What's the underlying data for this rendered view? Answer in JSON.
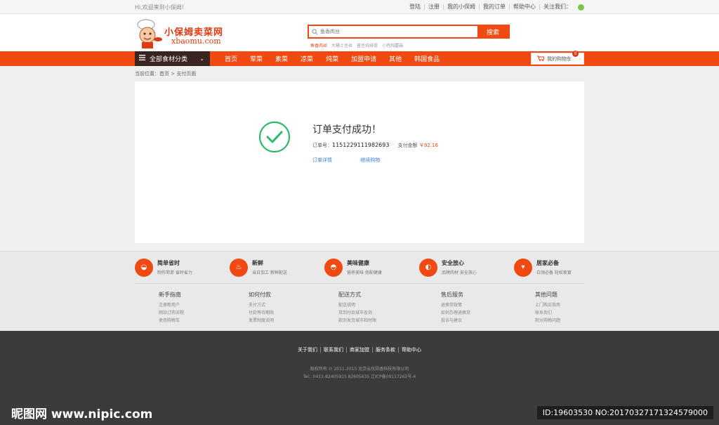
{
  "topbar": {
    "welcome": "Hi,欢迎来到小保姆!",
    "links": [
      "登陆",
      "注册",
      "我的小保姆",
      "我的订单",
      "帮助中心",
      "关注我们："
    ]
  },
  "header": {
    "logo_cn": "小保姆卖菜网",
    "logo_en": "xbaomu.com",
    "search_placeholder": "鱼香肉丝",
    "search_button": "搜索",
    "hot_words": [
      "鱼香肉丝",
      "大桶土豆丝",
      "普豆炖排骨",
      "小鸡炖蘑菇"
    ]
  },
  "nav": {
    "category_label": "全部食材分类",
    "menu": [
      "首页",
      "荤菜",
      "素菜",
      "凉菜",
      "炖菜",
      "加盟申请",
      "其他",
      "韩国食品"
    ],
    "cart_label": "我的购物车",
    "cart_count": "0"
  },
  "breadcrumb": "当前位置：首页 > 支付页面",
  "payment": {
    "title": "订单支付成功！",
    "order_label": "订单号：",
    "order_number": "1151229111982693",
    "amount_label": "支付金额",
    "amount": "￥92.16",
    "link_details": "订单详情",
    "link_continue": "继续购物"
  },
  "services": [
    {
      "title": "简单省时",
      "sub": "制作简单 省时省力",
      "icon": "bowl-icon"
    },
    {
      "title": "新鲜",
      "sub": "当日加工 新鲜配送",
      "icon": "soup-icon"
    },
    {
      "title": "美味健康",
      "sub": "营养美味 搭配健康",
      "icon": "dish-icon"
    },
    {
      "title": "安全放心",
      "sub": "品牌肉材 安全放心",
      "icon": "pan-icon"
    },
    {
      "title": "居家必备",
      "sub": "白领必备 轻松家宴",
      "icon": "cup-icon"
    }
  ],
  "help": [
    {
      "title": "新手指南",
      "links": [
        "注册新用户",
        "网站订购流程",
        "使用购物车"
      ]
    },
    {
      "title": "如何付款",
      "links": [
        "支付方式",
        "付款等待期限",
        "发票制度说明"
      ]
    },
    {
      "title": "配送方式",
      "links": [
        "配送说明",
        "货到付款城市查询",
        "款到发货城市和时限"
      ]
    },
    {
      "title": "售后服务",
      "links": [
        "退换货政策",
        "如何办理退换货",
        "投诉与建议"
      ]
    },
    {
      "title": "其他问题",
      "links": [
        "上门购买指南",
        "联系我们",
        "积分购物问题"
      ]
    }
  ],
  "footer": {
    "links": [
      "关于我们",
      "联系我们",
      "商家加盟",
      "服务条款",
      "帮助中心"
    ],
    "copyright": "版权所有 © 2011-2015 北京云优厨香科技有限公司",
    "contact": "Tel：0411-82405915 82605635 辽ICP备09117262号-4"
  },
  "watermark": {
    "left": "昵图网 www.nipic.com",
    "right": "ID:19603530 NO:20170327171324579000"
  },
  "colors": {
    "accent": "#f04a12",
    "success": "#2fb86a",
    "link": "#3b82d8",
    "dark_nav": "#3a2420"
  }
}
